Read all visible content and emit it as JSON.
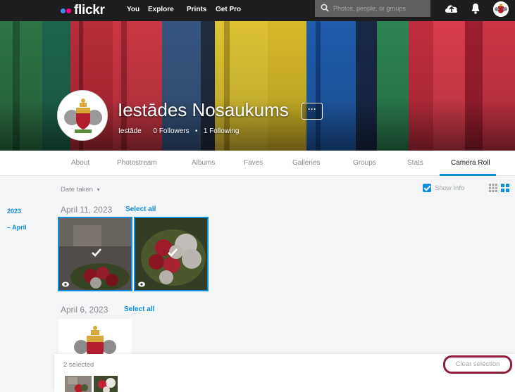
{
  "nav": {
    "logo_text": "flickr",
    "links": [
      "You",
      "Explore",
      "Prints",
      "Get Pro"
    ],
    "search_placeholder": "Photos, people, or groups",
    "icons": [
      "upload-cloud-icon",
      "bell-icon",
      "avatar"
    ]
  },
  "profile": {
    "name": "Iestādes Nosaukums",
    "more_label": "···",
    "handle": "Iestāde",
    "followers": "0 Followers",
    "separator": "•",
    "following": "1 Following"
  },
  "tabs": [
    {
      "label": "About",
      "active": false
    },
    {
      "label": "Photostream",
      "active": false
    },
    {
      "label": "Albums",
      "active": false
    },
    {
      "label": "Faves",
      "active": false
    },
    {
      "label": "Galleries",
      "active": false
    },
    {
      "label": "Groups",
      "active": false
    },
    {
      "label": "Stats",
      "active": false
    },
    {
      "label": "Camera Roll",
      "active": true
    }
  ],
  "toolbar": {
    "sort_label": "Date taken",
    "sort_caret": "▾",
    "show_info_label": "Show Info",
    "show_info_checked": true
  },
  "timeline": {
    "year": "2023",
    "month": "– April"
  },
  "groups": [
    {
      "date": "April 11, 2023",
      "select_all": "Select all"
    },
    {
      "date": "April 6, 2023",
      "select_all": "Select all"
    }
  ],
  "selection": {
    "count_label": "2 selected",
    "clear_label": "Clear selection"
  },
  "colors": {
    "accent": "#128fdc",
    "nav_bg": "#1d1d1f",
    "highlight": "#8e1d37",
    "flickr_blue": "#3d8fe6",
    "flickr_pink": "#ff0084"
  }
}
